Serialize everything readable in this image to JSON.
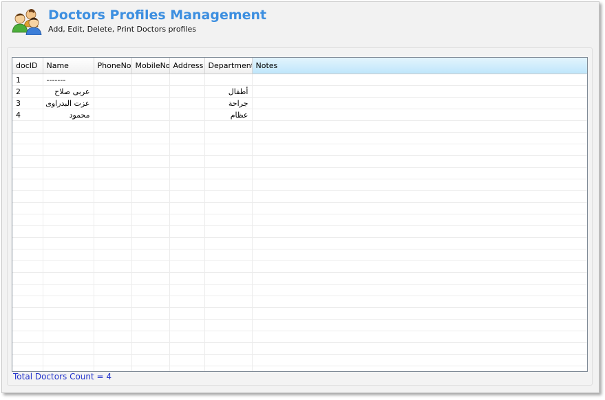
{
  "header": {
    "title": "Doctors Profiles Management",
    "subtitle": "Add, Edit, Delete, Print Doctors profiles",
    "icon": "users-group-icon"
  },
  "grid": {
    "columns": [
      "docID",
      "Name",
      "PhoneNo",
      "MobileNo",
      "Address",
      "Department",
      "Notes"
    ],
    "rows": [
      [
        "1",
        "-------",
        "",
        "",
        "",
        "",
        ""
      ],
      [
        "2",
        "عربى صلاح",
        "",
        "",
        "",
        "أطفال",
        ""
      ],
      [
        "3",
        "عزت البدراوى",
        "",
        "",
        "",
        "جراحة",
        ""
      ],
      [
        "4",
        "محمود",
        "",
        "",
        "",
        "عظام",
        ""
      ]
    ]
  },
  "status": {
    "text": "Total Doctors Count = 4"
  }
}
